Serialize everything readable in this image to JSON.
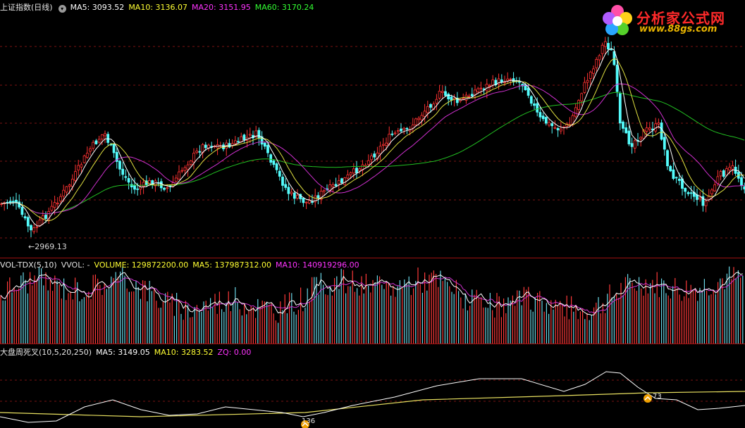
{
  "main_panel": {
    "title": "上证指数(日线)",
    "indicators": [
      {
        "label": "MA5: 3093.52",
        "color": "#ffffff"
      },
      {
        "label": "MA10: 3136.07",
        "color": "#ffff33"
      },
      {
        "label": "MA20: 3151.95",
        "color": "#ff33ff"
      },
      {
        "label": "MA60: 3170.24",
        "color": "#33ff33"
      }
    ],
    "low_label": "←2969.13"
  },
  "volume_panel": {
    "title": "VOL-TDX(5,10)",
    "indicators": [
      {
        "label": "VVOL: -",
        "color": "#dddddd"
      },
      {
        "label": "VOLUME: 129872200.00",
        "color": "#ffff33"
      },
      {
        "label": "MA5: 137987312.00",
        "color": "#ffff33"
      },
      {
        "label": "MA10: 140919296.00",
        "color": "#ff33ff"
      }
    ]
  },
  "indicator_panel": {
    "title": "大盘周死叉(10,5,20,250)",
    "indicators": [
      {
        "label": "MA5: 3149.05",
        "color": "#ffffff"
      },
      {
        "label": "MA10: 3283.52",
        "color": "#ffff33"
      },
      {
        "label": "ZQ: 0.00",
        "color": "#ff33ff"
      }
    ],
    "markers": [
      {
        "label": "136"
      },
      {
        "label": "73"
      }
    ]
  },
  "logo": {
    "brand": "分析家公式网",
    "url": "www.88gs.com"
  },
  "colors": {
    "up": "#ff3232",
    "down": "#54fcfc",
    "grid": "#7a1212",
    "background": "#000000"
  }
}
